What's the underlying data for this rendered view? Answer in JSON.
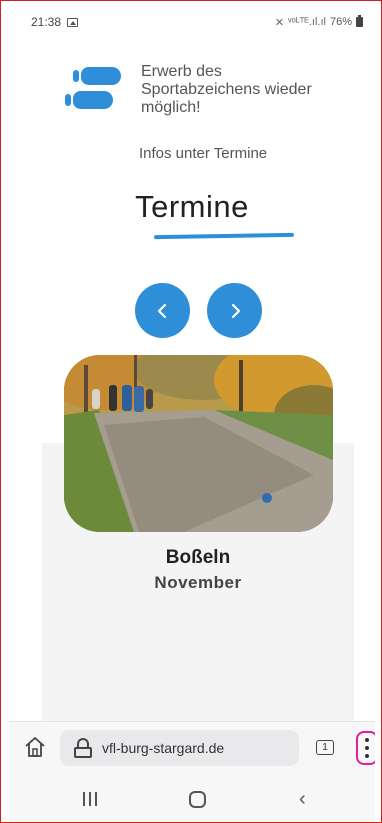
{
  "status_bar": {
    "time": "21:38",
    "signal": "ᵛᵒᴸᵀᴱ.ıl.ıl",
    "battery": "76%",
    "icons": [
      "image-icon",
      "mute-icon",
      "signal-icon",
      "battery-icon"
    ]
  },
  "notice": {
    "text": "Erwerb des Sportabzeichens wieder möglich!",
    "subtext": "Infos unter Termine"
  },
  "section": {
    "heading": "Termine"
  },
  "carousel": {
    "prev_icon": "chevron-left-icon",
    "next_icon": "chevron-right-icon"
  },
  "event": {
    "title": "Boßeln",
    "month": "November"
  },
  "browser": {
    "url": "vfl-burg-stargard.de",
    "tab_count": "1"
  },
  "colors": {
    "accent": "#2e8fd8",
    "highlight_outline": "#e0209a",
    "screenshot_border": "#d02020"
  }
}
